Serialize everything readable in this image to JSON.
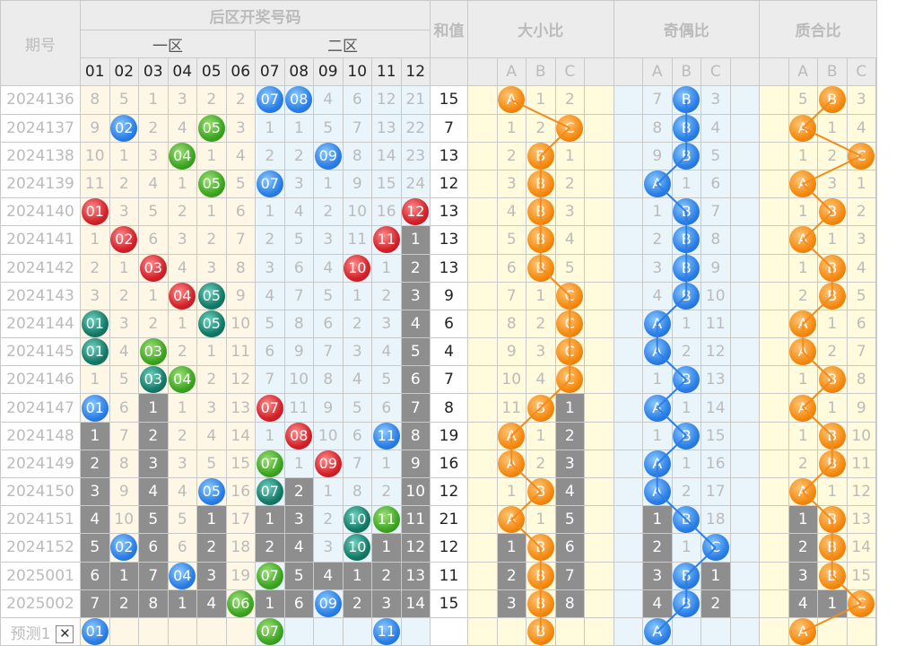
{
  "headers": {
    "period": "期号",
    "back_title": "后区开奖号码",
    "zone1": "一区",
    "zone2": "二区",
    "sum": "和值",
    "size": "大小比",
    "parity": "奇偶比",
    "prime": "质合比",
    "numbers": [
      "01",
      "02",
      "03",
      "04",
      "05",
      "06",
      "07",
      "08",
      "09",
      "10",
      "11",
      "12"
    ],
    "abc": [
      "A",
      "B",
      "C"
    ]
  },
  "rows": [
    {
      "period": "2024136",
      "cells": [
        "8",
        "5",
        "1",
        "3",
        "2",
        "2",
        "07",
        "08",
        "4",
        "6",
        "12",
        "21"
      ],
      "sum": "15",
      "size": [
        "A",
        "1",
        "2"
      ],
      "parity": [
        "7",
        "B",
        "3"
      ],
      "prime": [
        "5",
        "B",
        "3"
      ]
    },
    {
      "period": "2024137",
      "cells": [
        "9",
        "02",
        "2",
        "4",
        "05",
        "3",
        "1",
        "1",
        "5",
        "7",
        "13",
        "22"
      ],
      "sum": "7",
      "size": [
        "1",
        "2",
        "C"
      ],
      "parity": [
        "8",
        "B",
        "4"
      ],
      "prime": [
        "A",
        "1",
        "4"
      ]
    },
    {
      "period": "2024138",
      "cells": [
        "10",
        "1",
        "3",
        "04",
        "1",
        "4",
        "2",
        "2",
        "09",
        "8",
        "14",
        "23"
      ],
      "sum": "13",
      "size": [
        "2",
        "B",
        "1"
      ],
      "parity": [
        "9",
        "B",
        "5"
      ],
      "prime": [
        "1",
        "2",
        "C"
      ]
    },
    {
      "period": "2024139",
      "cells": [
        "11",
        "2",
        "4",
        "1",
        "05",
        "5",
        "07",
        "3",
        "1",
        "9",
        "15",
        "24"
      ],
      "sum": "12",
      "size": [
        "3",
        "B",
        "2"
      ],
      "parity": [
        "A",
        "1",
        "6"
      ],
      "prime": [
        "A",
        "3",
        "1"
      ]
    },
    {
      "period": "2024140",
      "cells": [
        "01",
        "3",
        "5",
        "2",
        "1",
        "6",
        "1",
        "4",
        "2",
        "10",
        "16",
        "12"
      ],
      "sum": "13",
      "size": [
        "4",
        "B",
        "3"
      ],
      "parity": [
        "1",
        "B",
        "7"
      ],
      "prime": [
        "1",
        "B",
        "2"
      ]
    },
    {
      "period": "2024141",
      "cells": [
        "1",
        "02",
        "6",
        "3",
        "2",
        "7",
        "2",
        "5",
        "3",
        "11",
        "11",
        "1"
      ],
      "sum": "13",
      "size": [
        "5",
        "B",
        "4"
      ],
      "parity": [
        "2",
        "B",
        "8"
      ],
      "prime": [
        "A",
        "1",
        "3"
      ]
    },
    {
      "period": "2024142",
      "cells": [
        "2",
        "1",
        "03",
        "4",
        "3",
        "8",
        "3",
        "6",
        "4",
        "10",
        "1",
        "2"
      ],
      "sum": "13",
      "size": [
        "6",
        "B",
        "5"
      ],
      "parity": [
        "3",
        "B",
        "9"
      ],
      "prime": [
        "1",
        "B",
        "4"
      ]
    },
    {
      "period": "2024143",
      "cells": [
        "3",
        "2",
        "1",
        "04",
        "05",
        "9",
        "4",
        "7",
        "5",
        "1",
        "2",
        "3"
      ],
      "sum": "9",
      "size": [
        "7",
        "1",
        "C"
      ],
      "parity": [
        "4",
        "B",
        "10"
      ],
      "prime": [
        "2",
        "B",
        "5"
      ]
    },
    {
      "period": "2024144",
      "cells": [
        "01",
        "3",
        "2",
        "1",
        "05",
        "10",
        "5",
        "8",
        "6",
        "2",
        "3",
        "4"
      ],
      "sum": "6",
      "size": [
        "8",
        "2",
        "C"
      ],
      "parity": [
        "A",
        "1",
        "11"
      ],
      "prime": [
        "A",
        "1",
        "6"
      ]
    },
    {
      "period": "2024145",
      "cells": [
        "01",
        "4",
        "03",
        "2",
        "1",
        "11",
        "6",
        "9",
        "7",
        "3",
        "4",
        "5"
      ],
      "sum": "4",
      "size": [
        "9",
        "3",
        "C"
      ],
      "parity": [
        "A",
        "2",
        "12"
      ],
      "prime": [
        "A",
        "2",
        "7"
      ]
    },
    {
      "period": "2024146",
      "cells": [
        "1",
        "5",
        "03",
        "04",
        "2",
        "12",
        "7",
        "10",
        "8",
        "4",
        "5",
        "6"
      ],
      "sum": "7",
      "size": [
        "10",
        "4",
        "C"
      ],
      "parity": [
        "1",
        "B",
        "13"
      ],
      "prime": [
        "1",
        "B",
        "8"
      ]
    },
    {
      "period": "2024147",
      "cells": [
        "01",
        "6",
        "1",
        "1",
        "3",
        "13",
        "07",
        "11",
        "9",
        "5",
        "6",
        "7"
      ],
      "sum": "8",
      "size": [
        "11",
        "B",
        "1"
      ],
      "parity": [
        "A",
        "1",
        "14"
      ],
      "prime": [
        "A",
        "1",
        "9"
      ]
    },
    {
      "period": "2024148",
      "cells": [
        "1",
        "7",
        "2",
        "2",
        "4",
        "14",
        "1",
        "08",
        "10",
        "6",
        "11",
        "8"
      ],
      "sum": "19",
      "size": [
        "A",
        "1",
        "2"
      ],
      "parity": [
        "1",
        "B",
        "15"
      ],
      "prime": [
        "1",
        "B",
        "10"
      ]
    },
    {
      "period": "2024149",
      "cells": [
        "2",
        "8",
        "3",
        "3",
        "5",
        "15",
        "07",
        "1",
        "09",
        "7",
        "1",
        "9"
      ],
      "sum": "16",
      "size": [
        "A",
        "2",
        "3"
      ],
      "parity": [
        "A",
        "1",
        "16"
      ],
      "prime": [
        "2",
        "B",
        "11"
      ]
    },
    {
      "period": "2024150",
      "cells": [
        "3",
        "9",
        "4",
        "4",
        "05",
        "16",
        "07",
        "2",
        "1",
        "8",
        "2",
        "10"
      ],
      "sum": "12",
      "size": [
        "1",
        "B",
        "4"
      ],
      "parity": [
        "A",
        "2",
        "17"
      ],
      "prime": [
        "A",
        "1",
        "12"
      ]
    },
    {
      "period": "2024151",
      "cells": [
        "4",
        "10",
        "5",
        "5",
        "1",
        "17",
        "1",
        "3",
        "2",
        "10",
        "11",
        "11"
      ],
      "sum": "21",
      "size": [
        "A",
        "1",
        "5"
      ],
      "parity": [
        "1",
        "B",
        "18"
      ],
      "prime": [
        "1",
        "B",
        "13"
      ]
    },
    {
      "period": "2024152",
      "cells": [
        "5",
        "02",
        "6",
        "6",
        "2",
        "18",
        "2",
        "4",
        "3",
        "10",
        "1",
        "12"
      ],
      "sum": "12",
      "size": [
        "1",
        "B",
        "6"
      ],
      "parity": [
        "2",
        "1",
        "C"
      ],
      "prime": [
        "2",
        "B",
        "14"
      ]
    },
    {
      "period": "2025001",
      "cells": [
        "6",
        "1",
        "7",
        "04",
        "3",
        "19",
        "07",
        "5",
        "4",
        "1",
        "2",
        "13"
      ],
      "sum": "11",
      "size": [
        "2",
        "B",
        "7"
      ],
      "parity": [
        "3",
        "B",
        "1"
      ],
      "prime": [
        "3",
        "B",
        "15"
      ]
    },
    {
      "period": "2025002",
      "cells": [
        "7",
        "2",
        "8",
        "1",
        "4",
        "06",
        "1",
        "6",
        "09",
        "2",
        "3",
        "14"
      ],
      "sum": "15",
      "size": [
        "3",
        "B",
        "8"
      ],
      "parity": [
        "4",
        "B",
        "2"
      ],
      "prime": [
        "4",
        "1",
        "C"
      ]
    }
  ],
  "prediction": {
    "label": "预测1",
    "close": "✕",
    "balls": {
      "c0": "01",
      "c6": "07",
      "c10": "11"
    },
    "size": "B",
    "parity": "A",
    "prime": "A"
  }
}
